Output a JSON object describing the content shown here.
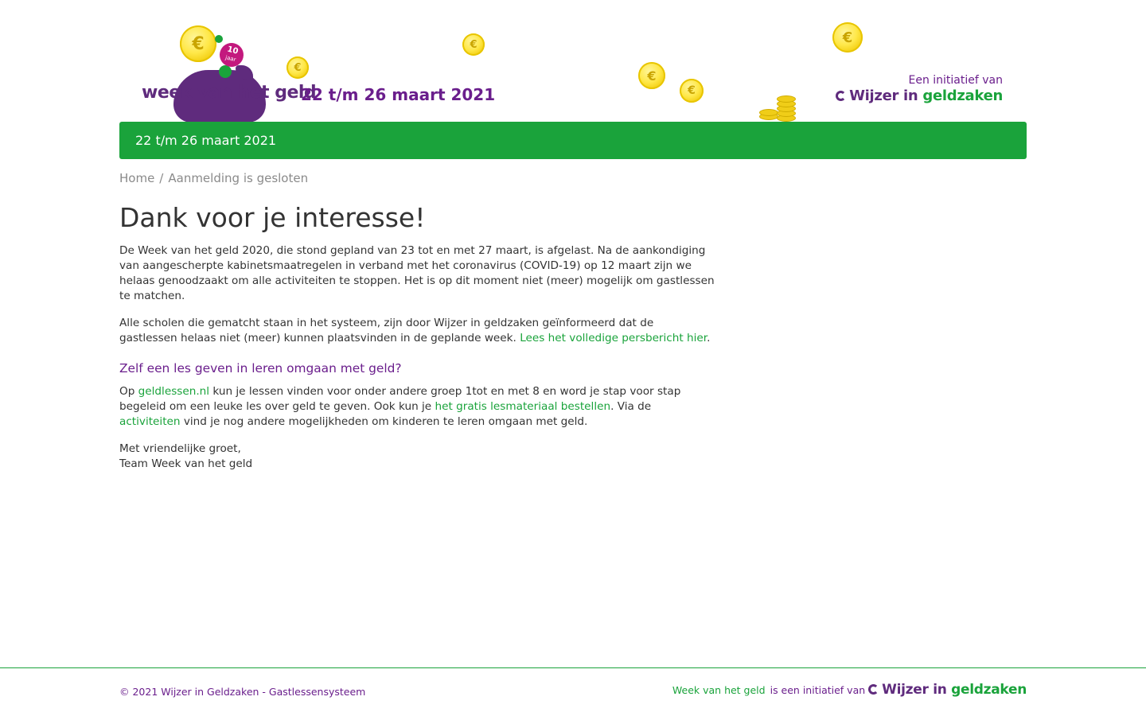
{
  "header": {
    "logo_text": "week van het geld",
    "badge_number": "10",
    "badge_word": "jaar",
    "date": "22 t/m 26 maart 2021",
    "initiatief_label": "Een initiatief van",
    "partner_logo": {
      "part1": "Wijzer in",
      "part2": "geldzaken"
    }
  },
  "banner": {
    "text": "22 t/m 26 maart 2021"
  },
  "breadcrumb": {
    "home": "Home",
    "separator": "/",
    "current": "Aanmelding is gesloten"
  },
  "main": {
    "title": "Dank voor je interesse!",
    "paragraph1": "De Week van het geld 2020, die stond gepland van 23 tot en met 27 maart, is afgelast. Na de aankondiging van aangescherpte kabinetsmaatregelen in verband met het coronavirus (COVID-19) op 12 maart zijn we helaas genoodzaakt om alle activiteiten te stoppen. Het is op dit moment niet (meer) mogelijk om gastlessen te matchen.",
    "paragraph2_text": "Alle scholen die gematcht staan in het systeem, zijn door Wijzer in geldzaken geïnformeerd dat de gastlessen helaas niet (meer) kunnen plaatsvinden in de geplande week. ",
    "paragraph2_link": "Lees het volledige persbericht hier",
    "paragraph2_end": ".",
    "subheading": "Zelf een les geven in leren omgaan met geld?",
    "paragraph3": {
      "t1": "Op ",
      "link1": "geldlessen.nl",
      "t2": " kun je lessen vinden voor onder andere groep 1tot en met 8 en word je stap voor stap begeleid om een leuke les over geld te geven. Ook kun je ",
      "link2": "het gratis lesmateriaal bestellen",
      "t3": ". Via de ",
      "link3": "activiteiten",
      "t4": " vind je nog andere mogelijkheden om kinderen te leren omgaan met geld."
    },
    "closing_line1": "Met vriendelijke groet,",
    "closing_line2": "Team Week van het geld"
  },
  "footer": {
    "copyright": "© 2021 Wijzer in Geldzaken - Gastlessensysteem",
    "link": "Week van het geld",
    "initiatief_text": "is een initiatief van",
    "partner_logo": {
      "part1": "Wijzer in",
      "part2": "geldzaken"
    }
  },
  "icons": {
    "coin": "euro-coin-icon",
    "coin_symbol": "€"
  },
  "colors": {
    "brand_purple": "#6a1e8c",
    "brand_green": "#1aa33b",
    "coin_yellow": "#ffe84a"
  }
}
